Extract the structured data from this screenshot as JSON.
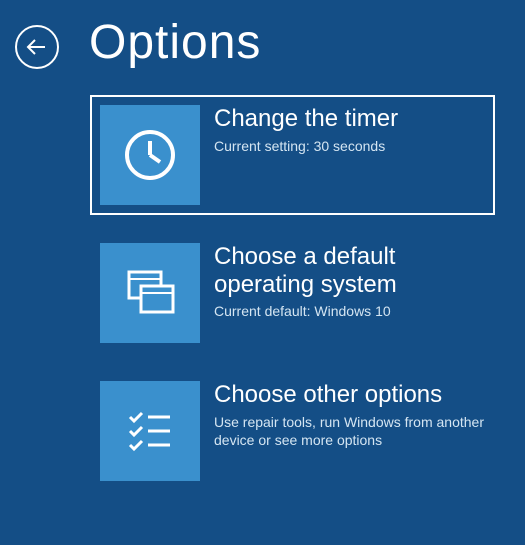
{
  "header": {
    "title": "Options"
  },
  "options": [
    {
      "title": "Change the timer",
      "subtitle": "Current setting: 30 seconds",
      "icon": "clock",
      "focused": true
    },
    {
      "title": "Choose a default operating system",
      "subtitle": "Current default: Windows 10",
      "icon": "windows",
      "focused": false
    },
    {
      "title": "Choose other options",
      "subtitle": "Use repair tools, run Windows from another device or see more options",
      "icon": "checklist",
      "focused": false
    }
  ]
}
